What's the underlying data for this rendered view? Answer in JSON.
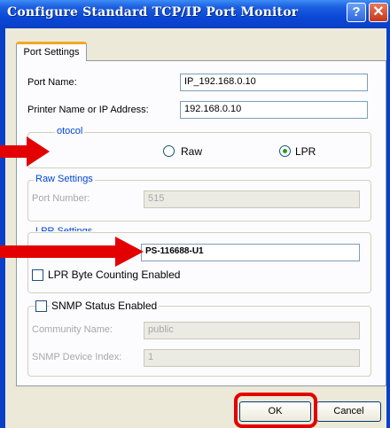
{
  "window": {
    "title": "Configure Standard TCP/IP Port Monitor",
    "help_glyph": "?",
    "close_glyph": "✕"
  },
  "tabs": [
    {
      "label": "Port Settings"
    }
  ],
  "port_name": {
    "label": "Port Name:",
    "value": "IP_192.168.0.10"
  },
  "printer_name": {
    "label": "Printer Name or IP Address:",
    "value": "192.168.0.10"
  },
  "protocol": {
    "legend": "Protocol",
    "legend_visible": "otocol",
    "options": [
      {
        "label": "Raw",
        "selected": false
      },
      {
        "label": "LPR",
        "selected": true
      }
    ]
  },
  "raw_settings": {
    "legend": "Raw Settings",
    "port_number_label": "Port Number:",
    "port_number_value": "515"
  },
  "lpr_settings": {
    "legend": "LPR Settings",
    "legend_visible": "LPR Settings",
    "queue_name_value": "PS-116688-U1",
    "byte_counting_label": "LPR Byte Counting Enabled",
    "byte_counting_checked": false
  },
  "snmp": {
    "status_label": "SNMP Status Enabled",
    "status_checked": false,
    "community_label": "Community Name:",
    "community_value": "public",
    "device_index_label": "SNMP Device Index:",
    "device_index_value": "1"
  },
  "buttons": {
    "ok": "OK",
    "cancel": "Cancel"
  },
  "annotations": {
    "arrow_color": "#e20000",
    "highlight_color": "#e20000"
  },
  "colors": {
    "titlebar": "#0a48d6",
    "dialog_bg": "#ece9d8",
    "accent_tab": "#f5a623",
    "group_legend": "#0046d5"
  }
}
